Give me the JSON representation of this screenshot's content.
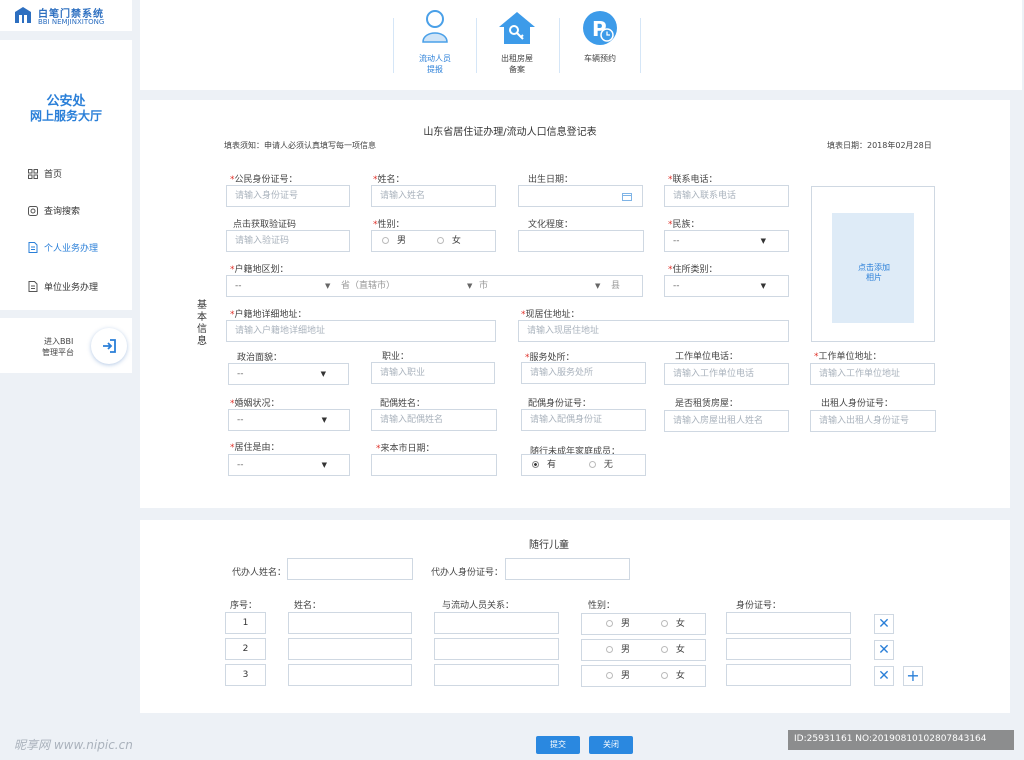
{
  "brand": {
    "title": "白笔门禁系统",
    "subtitle": "BBI  NEMJINXITONG"
  },
  "sidebar": {
    "org_line1": "公安处",
    "org_line2": "网上服务大厅",
    "items": [
      {
        "label": "首页",
        "icon": "grid-icon"
      },
      {
        "label": "查询搜索",
        "icon": "search-icon"
      },
      {
        "label": "个人业务办理",
        "icon": "document-icon",
        "active": true
      },
      {
        "label": "单位业务办理",
        "icon": "document-icon"
      }
    ],
    "enter_line1": "进入BBI",
    "enter_line2": "管理平台"
  },
  "topnav": [
    {
      "line1": "流动人员",
      "line2": "提报",
      "icon": "person-icon",
      "active": true
    },
    {
      "line1": "出租房屋",
      "line2": "备案",
      "icon": "house-key-icon"
    },
    {
      "line1": "车辆预约",
      "line2": "",
      "icon": "parking-clock-icon"
    }
  ],
  "form": {
    "title": "山东省居住证办理/流动人口信息登记表",
    "notice": "填表须知：申请人必须认真填写每一项信息",
    "date": "填表日期：2018年02月28日",
    "section_label": "基本信息",
    "photo_text_1": "点击添加",
    "photo_text_2": "相片",
    "fields": {
      "id_label": "公民身份证号：",
      "id_ph": "请输入身份证号",
      "name_label": "姓名：",
      "name_ph": "请输入姓名",
      "birth_label": "出生日期：",
      "phone_label": "联系电话：",
      "phone_ph": "请输入联系电话",
      "getcode_link": "点击获取验证码",
      "code_ph": "请输入验证码",
      "gender_label": "性别：",
      "male": "男",
      "female": "女",
      "edu_label": "文化程度：",
      "ethnic_label": "民族：",
      "ethnic_val": "--",
      "hukou_label": "户籍地区划：",
      "hukou_v1": "--",
      "hukou_province": "省（直辖市）",
      "hukou_city": "市",
      "hukou_county": "县",
      "residence_type_label": "住所类别：",
      "residence_type_val": "--",
      "hukou_addr_label": "户籍地详细地址：",
      "hukou_addr_ph": "请输入户籍地详细地址",
      "cur_addr_label": "现居住地址：",
      "cur_addr_ph": "请输入现居住地址",
      "politics_label": "政治面貌：",
      "politics_val": "--",
      "job_label": "职业：",
      "job_ph": "请输入职业",
      "service_label": "服务处所：",
      "service_ph": "请输入服务处所",
      "work_phone_label": "工作单位电话：",
      "work_phone_ph": "请输入工作单位电话",
      "work_addr_label": "工作单位地址：",
      "work_addr_ph": "请输入工作单位地址",
      "marital_label": "婚姻状况：",
      "marital_val": "--",
      "spouse_name_label": "配偶姓名：",
      "spouse_name_ph": "请输入配偶姓名",
      "spouse_id_label": "配偶身份证号：",
      "spouse_id_ph": "请输入配偶身份证",
      "rent_label": "是否租赁房屋：",
      "rent_ph": "请输入房屋出租人姓名",
      "landlord_id_label": "出租人身份证号：",
      "landlord_id_ph": "请输入出租人身份证号",
      "reason_label": "居住是由：",
      "reason_val": "--",
      "arrival_label": "来本市日期：",
      "minors_label": "随行未成年家庭成员：",
      "minors_yes": "有",
      "minors_no": "无"
    }
  },
  "children": {
    "title": "随行儿童",
    "agent_name_label": "代办人姓名：",
    "agent_id_label": "代办人身份证号：",
    "col_no": "序号：",
    "col_name": "姓名：",
    "col_relation": "与流动人员关系：",
    "col_gender": "性别：",
    "col_id": "身份证号：",
    "rows": [
      {
        "no": "1",
        "male": "男",
        "female": "女"
      },
      {
        "no": "2",
        "male": "男",
        "female": "女"
      },
      {
        "no": "3",
        "male": "男",
        "female": "女"
      }
    ]
  },
  "actions": {
    "submit": "提交",
    "close": "关闭"
  },
  "watermark": {
    "left": "昵享网 www.nipic.cn",
    "right": "ID:25931161 NO:20190810102807843164"
  }
}
